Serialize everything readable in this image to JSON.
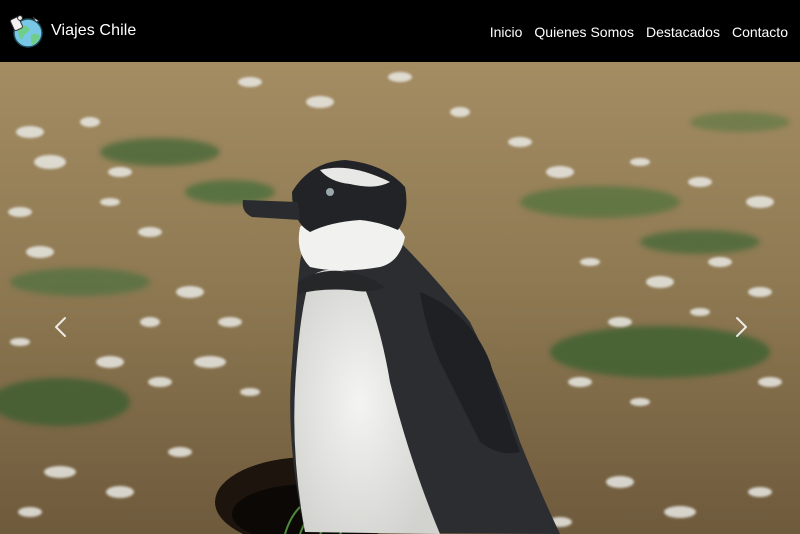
{
  "brand": {
    "name": "Viajes Chile",
    "logo_icon": "globe-traveler-icon"
  },
  "nav": {
    "items": [
      {
        "label": "Inicio"
      },
      {
        "label": "Quienes Somos"
      },
      {
        "label": "Destacados"
      },
      {
        "label": "Contacto"
      }
    ]
  },
  "carousel": {
    "image_alt": "Pingüino de Magallanes junto a su madriguera",
    "prev_icon": "chevron-left-icon",
    "next_icon": "chevron-right-icon"
  },
  "colors": {
    "navbar_bg": "#000000",
    "nav_text": "#ffffff",
    "logo_green": "#6fcf8a",
    "logo_blue": "#78c7e6"
  }
}
